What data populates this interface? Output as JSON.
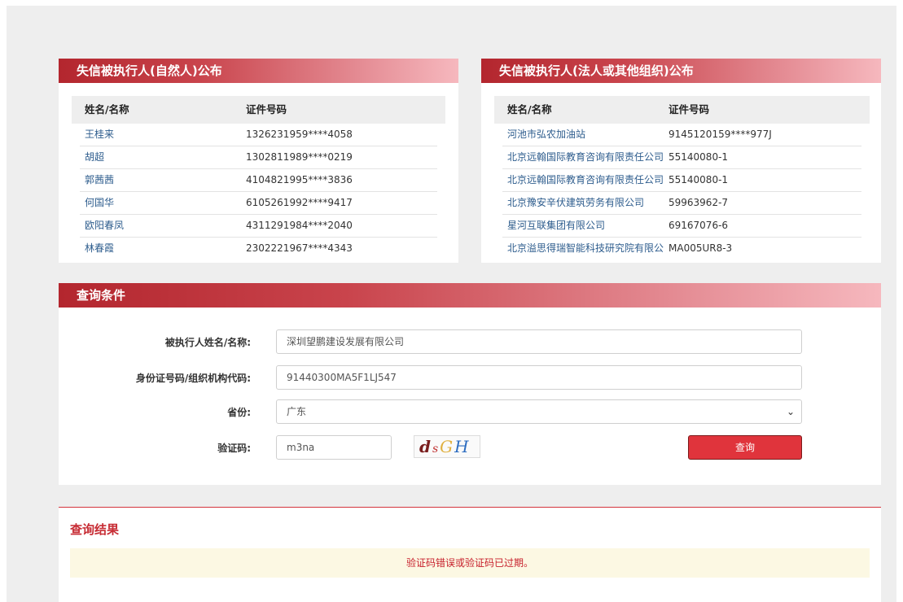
{
  "natural_panel": {
    "title": "失信被执行人(自然人)公布",
    "col_name": "姓名/名称",
    "col_id": "证件号码",
    "rows": [
      {
        "name": "王桂来",
        "id": "1326231959****4058"
      },
      {
        "name": "胡超",
        "id": "1302811989****0219"
      },
      {
        "name": "郭茜茜",
        "id": "4104821995****3836"
      },
      {
        "name": "何国华",
        "id": "6105261992****9417"
      },
      {
        "name": "欧阳春凤",
        "id": "4311291984****2040"
      },
      {
        "name": "林春霞",
        "id": "2302221967****4343"
      }
    ]
  },
  "legal_panel": {
    "title": "失信被执行人(法人或其他组织)公布",
    "col_name": "姓名/名称",
    "col_id": "证件号码",
    "rows": [
      {
        "name": "河池市弘农加油站",
        "id": "9145120159****977J"
      },
      {
        "name": "北京远翰国际教育咨询有限责任公司",
        "id": "55140080-1"
      },
      {
        "name": "北京远翰国际教育咨询有限责任公司",
        "id": "55140080-1"
      },
      {
        "name": "北京豫安辛伏建筑劳务有限公司",
        "id": "59963962-7"
      },
      {
        "name": "星河互联集团有限公司",
        "id": "69167076-6"
      },
      {
        "name": "北京溢思得瑞智能科技研究院有限公",
        "id": "MA005UR8-3"
      }
    ]
  },
  "query": {
    "title": "查询条件",
    "name_label": "被执行人姓名/名称:",
    "name_value": "深圳望鹏建设发展有限公司",
    "id_label": "身份证号码/组织机构代码:",
    "id_value": "91440300MA5F1LJ547",
    "province_label": "省份:",
    "province_value": "广东",
    "captcha_label": "验证码:",
    "captcha_value": "m3na",
    "captcha_chars": [
      "d",
      "s",
      "G",
      "H"
    ],
    "submit_label": "查询"
  },
  "result": {
    "title": "查询结果",
    "message": "验证码错误或验证码已过期。"
  }
}
